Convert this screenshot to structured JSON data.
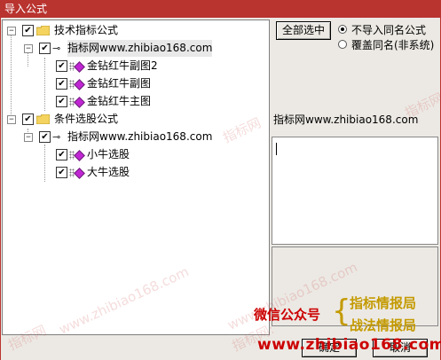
{
  "window": {
    "title": "导入公式"
  },
  "tree": {
    "groups": [
      {
        "label": "技术指标公式",
        "expander": "−",
        "source": {
          "label": "指标网www.zhibiao168.com",
          "expander": "−",
          "items": [
            {
              "label": "金钻红牛副图2"
            },
            {
              "label": "金钻红牛副图"
            },
            {
              "label": "金钻红牛主图"
            }
          ]
        }
      },
      {
        "label": "条件选股公式",
        "expander": "−",
        "source": {
          "label": "指标网www.zhibiao168.com",
          "expander": "−",
          "items": [
            {
              "label": "小牛选股"
            },
            {
              "label": "大牛选股"
            }
          ]
        }
      }
    ],
    "check_mark": "✔"
  },
  "controls": {
    "select_all": "全部选中",
    "options": [
      {
        "label": "不导入同名公式",
        "selected": true
      },
      {
        "label": "覆盖同名(非系统)",
        "selected": false
      }
    ]
  },
  "info": {
    "source": "指标网www.zhibiao168.com"
  },
  "watermarks": [
    "指标网",
    "指标网",
    "www.zhibiao168.com",
    "指标网",
    "www.zhibiao168.com",
    "指标网:"
  ],
  "promo": {
    "wechat": "微信公众号",
    "brace": "{",
    "line1": "指标情报局",
    "line2": "战法情报局",
    "url": "www.zhibiao168.com"
  },
  "buttons": {
    "ok": "确定",
    "cancel": "取消"
  },
  "colors": {
    "title_bar": "#b9332f",
    "check_item": "#c026d3",
    "promo_red": "#cc0000",
    "promo_gold": "#c49a00"
  }
}
